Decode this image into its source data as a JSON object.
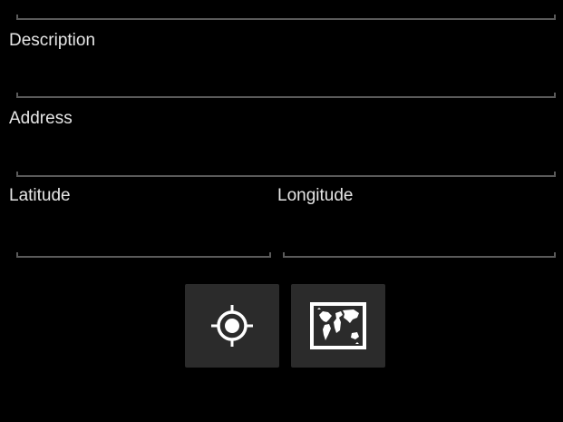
{
  "form": {
    "description": {
      "label": "Description",
      "value": ""
    },
    "address": {
      "label": "Address",
      "value": ""
    },
    "latitude": {
      "label": "Latitude",
      "value": ""
    },
    "longitude": {
      "label": "Longitude",
      "value": ""
    }
  },
  "actions": {
    "locate_icon": "gps-locate-icon",
    "map_icon": "world-map-icon"
  },
  "colors": {
    "background": "#000000",
    "underline": "#5a5a5a",
    "button_bg": "#2b2b2b",
    "icon": "#ffffff"
  }
}
